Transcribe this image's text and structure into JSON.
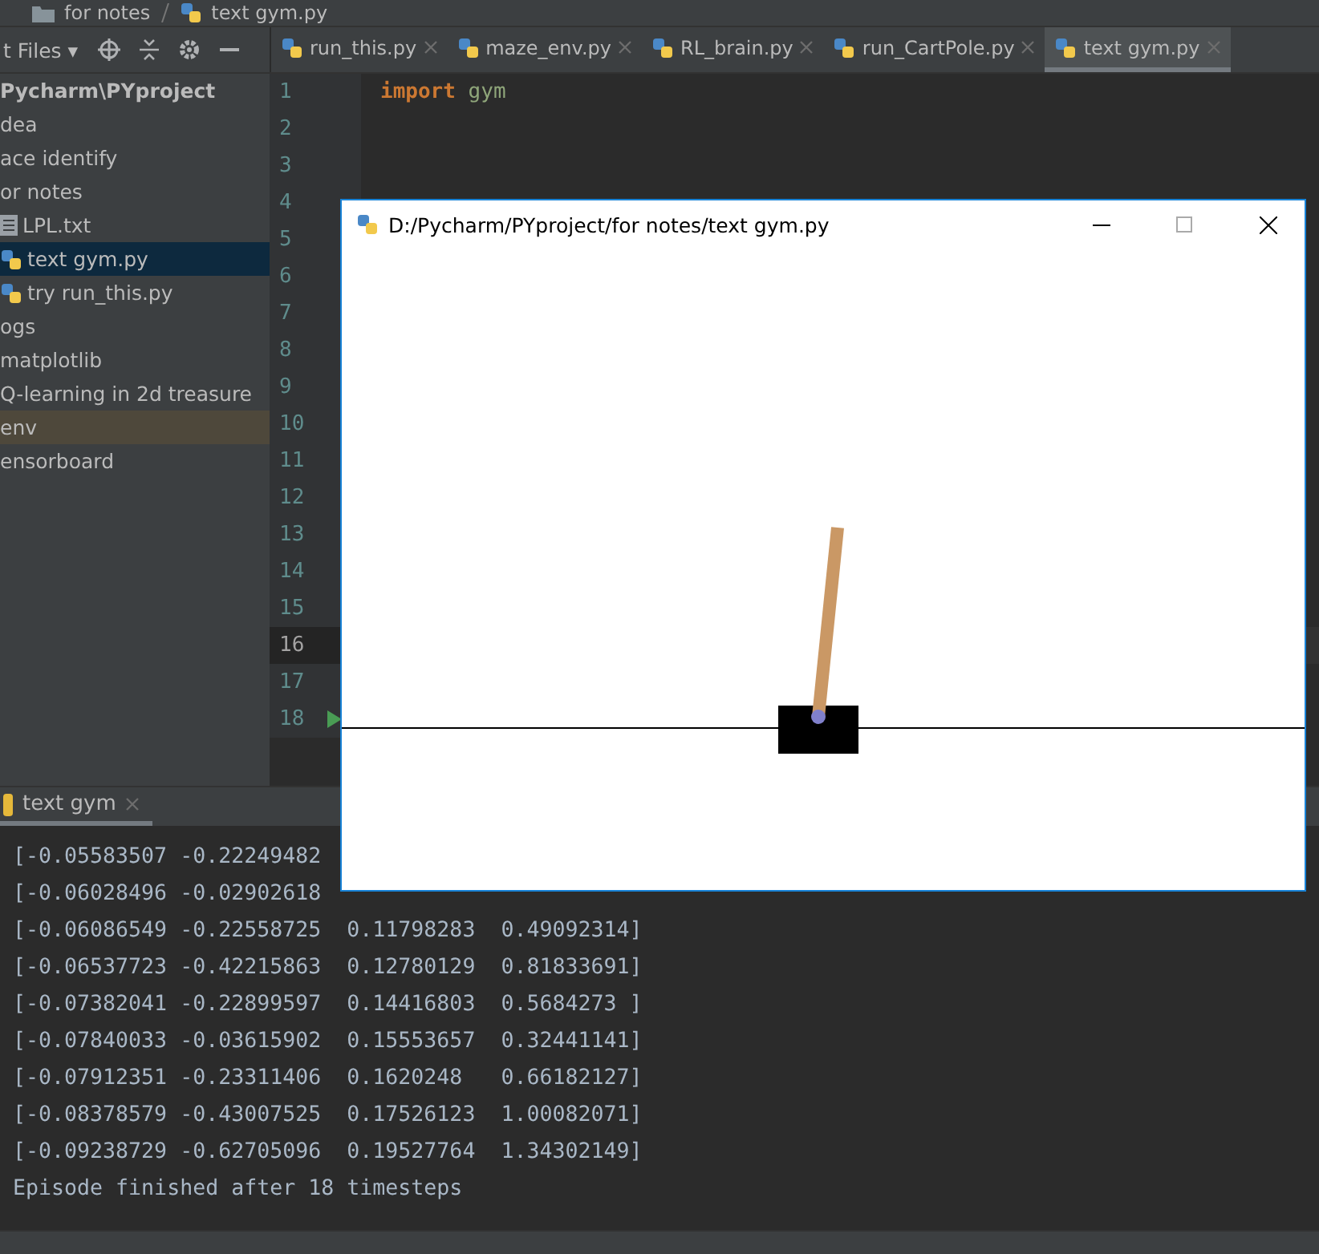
{
  "breadcrumb": [
    {
      "label": "for notes",
      "kind": "folder"
    },
    {
      "label": "text gym.py",
      "kind": "python"
    }
  ],
  "project_panel": {
    "title": "t Files ▾"
  },
  "tabs": [
    {
      "label": "run_this.py",
      "selected": false
    },
    {
      "label": "maze_env.py",
      "selected": false
    },
    {
      "label": "RL_brain.py",
      "selected": false
    },
    {
      "label": "run_CartPole.py",
      "selected": false
    },
    {
      "label": "text gym.py",
      "selected": true
    }
  ],
  "tree": {
    "label": "Pycharm\\PYproject",
    "selected": false,
    "highlighted": false,
    "children": [
      {
        "label": "dea",
        "selected": false,
        "highlighted": false
      },
      {
        "label": "ace identify",
        "selected": false,
        "highlighted": false
      },
      {
        "label": "or notes",
        "selected": false,
        "highlighted": false,
        "children": [
          {
            "label": "LPL.txt",
            "kind": "text",
            "selected": false,
            "highlighted": false
          },
          {
            "label": "text gym.py",
            "kind": "python",
            "selected": true,
            "highlighted": false
          },
          {
            "label": "try run_this.py",
            "kind": "python",
            "selected": false,
            "highlighted": false
          }
        ]
      },
      {
        "label": "ogs",
        "selected": false,
        "highlighted": false
      },
      {
        "label": "matplotlib",
        "selected": false,
        "highlighted": false
      },
      {
        "label": "Q-learning in 2d treasure",
        "selected": false,
        "highlighted": false
      },
      {
        "label": "env",
        "selected": false,
        "highlighted": true
      },
      {
        "label": "ensorboard",
        "selected": false,
        "highlighted": false
      }
    ]
  },
  "editor": {
    "lines": [
      {
        "number": "1",
        "current": false,
        "run": false,
        "tokens": [
          {
            "text": "import",
            "kind": "keyword"
          },
          {
            "text": " gym",
            "kind": "name"
          }
        ]
      },
      {
        "number": "2",
        "current": false,
        "run": false
      },
      {
        "number": "3",
        "current": false,
        "run": false
      },
      {
        "number": "4",
        "current": false,
        "run": false
      },
      {
        "number": "5",
        "current": false,
        "run": false
      },
      {
        "number": "6",
        "current": false,
        "run": false
      },
      {
        "number": "7",
        "current": false,
        "run": false
      },
      {
        "number": "8",
        "current": false,
        "run": false
      },
      {
        "number": "9",
        "current": false,
        "run": false
      },
      {
        "number": "10",
        "current": false,
        "run": false
      },
      {
        "number": "11",
        "current": false,
        "run": false
      },
      {
        "number": "12",
        "current": false,
        "run": false
      },
      {
        "number": "13",
        "current": false,
        "run": false
      },
      {
        "number": "14",
        "current": false,
        "run": false
      },
      {
        "number": "15",
        "current": false,
        "run": false
      },
      {
        "number": "16",
        "current": true,
        "run": false
      },
      {
        "number": "17",
        "current": false,
        "run": false
      },
      {
        "number": "18",
        "current": false,
        "run": true
      }
    ]
  },
  "run_panel": {
    "tab": "text gym",
    "output": [
      "[-0.05583507 -0.22249482",
      "[-0.06028496 -0.02902618",
      "[-0.06086549 -0.22558725  0.11798283  0.49092314]",
      "[-0.06537723 -0.42215863  0.12780129  0.81833691]",
      "[-0.07382041 -0.22899597  0.14416803  0.5684273 ]",
      "[-0.07840033 -0.03615902  0.15553657  0.32441141]",
      "[-0.07912351 -0.23311406  0.1620248   0.66182127]",
      "[-0.08378579 -0.43007525  0.17526123  1.00082071]",
      "[-0.09238729 -0.62705096  0.19527764  1.34302149]",
      "Episode finished after 18 timesteps"
    ]
  },
  "gym_window": {
    "title": "D:/Pycharm/PYproject/for notes/text gym.py"
  }
}
